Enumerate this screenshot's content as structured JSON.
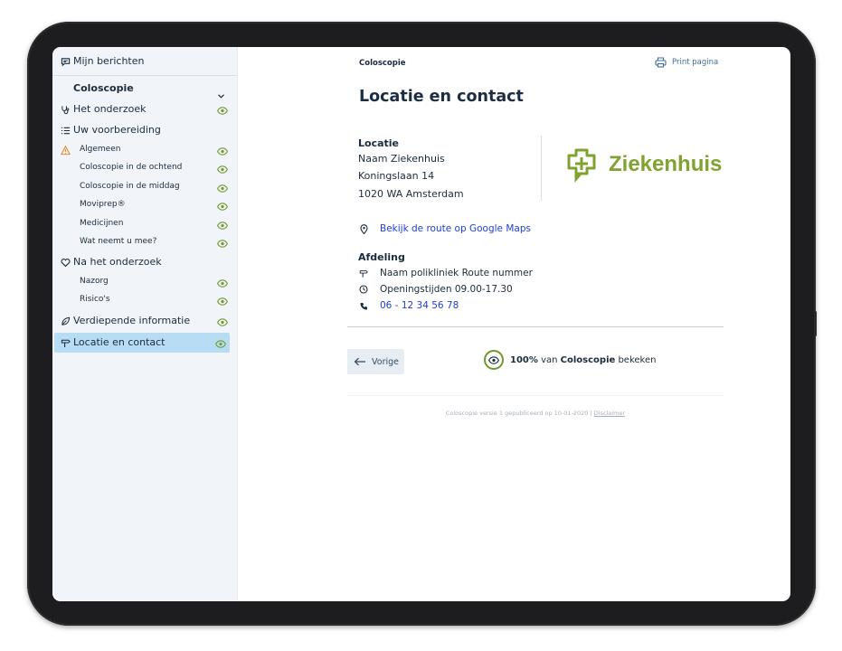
{
  "sidebar": {
    "messages": "Mijn berichten",
    "section_title": "Coloscopie",
    "items": [
      {
        "label": "Het onderzoek",
        "level": 1,
        "icon": "stethoscope-icon"
      },
      {
        "label": "Uw voorbereiding",
        "level": 1,
        "icon": "list-icon"
      },
      {
        "label": "Algemeen",
        "level": 2,
        "icon": "warning-icon"
      },
      {
        "label": "Coloscopie in de ochtend",
        "level": 2
      },
      {
        "label": "Coloscopie in de middag",
        "level": 2
      },
      {
        "label": "Moviprep®",
        "level": 2
      },
      {
        "label": "Medicijnen",
        "level": 2
      },
      {
        "label": "Wat neemt u mee?",
        "level": 2
      },
      {
        "label": "Na het onderzoek",
        "level": 1,
        "icon": "heart-icon"
      },
      {
        "label": "Nazorg",
        "level": 2
      },
      {
        "label": "Risico's",
        "level": 2
      },
      {
        "label": "Verdiepende informatie",
        "level": 1,
        "icon": "leaf-icon"
      },
      {
        "label": "Locatie en contact",
        "level": 1,
        "icon": "signpost-icon",
        "active": true
      }
    ]
  },
  "main": {
    "breadcrumb": "Coloscopie",
    "print_label": "Print pagina",
    "title": "Locatie en contact",
    "location": {
      "heading": "Locatie",
      "name": "Naam Ziekenhuis",
      "street": "Koningslaan 14",
      "city": "1020 WA Amsterdam"
    },
    "logo_text": "Ziekenhuis",
    "route_link": "Bekijk de route op Google Maps",
    "department": {
      "heading": "Afdeling",
      "clinic": "Naam polikliniek Route nummer",
      "hours": "Openingstijden 09.00-17.30",
      "phone": "06 - 12 34 56 78"
    },
    "prev_label": "Vorige",
    "progress": {
      "percent": "100%",
      "mid": " van ",
      "subject": "Coloscopie",
      "suffix": " bekeken"
    },
    "footer": {
      "text": "Coloscopie versie 1 gepubliceerd op 10-01-2020 | ",
      "link": "Disclaimer"
    }
  },
  "colors": {
    "accent": "#7fa32e",
    "link": "#1d3fce",
    "active_bg": "#b9dcf5",
    "eye": "#6f9a2b",
    "warning": "#e8892b"
  }
}
